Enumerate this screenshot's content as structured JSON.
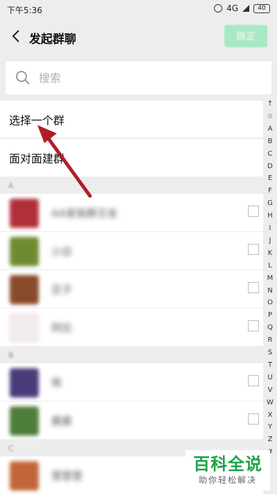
{
  "status_bar": {
    "time": "下午5:36",
    "network": "4G",
    "battery": "40"
  },
  "navbar": {
    "title": "发起群聊",
    "confirm_label": "确定"
  },
  "search": {
    "placeholder": "搜索"
  },
  "options": [
    {
      "label": "选择一个群"
    },
    {
      "label": "面对面建群"
    }
  ],
  "sections": [
    {
      "header": "A"
    },
    {
      "header": "B"
    },
    {
      "header": "C"
    }
  ],
  "contacts": [
    {
      "name": "AA家族群交友",
      "avatar_color": "#b0303a"
    },
    {
      "name": "小白",
      "avatar_color": "#6f8b2f"
    },
    {
      "name": "豆子",
      "avatar_color": "#8a4a2a"
    },
    {
      "name": "阿拉",
      "avatar_color": "#f2eded"
    },
    {
      "name": "雨",
      "avatar_color": "#4b3a7a"
    },
    {
      "name": "晨晨",
      "avatar_color": "#4f7d3a"
    },
    {
      "name": "慧慧慧",
      "avatar_color": "#c2663a"
    }
  ],
  "index_letters": [
    "↑",
    "☆",
    "A",
    "B",
    "C",
    "D",
    "E",
    "F",
    "G",
    "H",
    "I",
    "J",
    "K",
    "L",
    "M",
    "N",
    "O",
    "P",
    "Q",
    "R",
    "S",
    "T",
    "U",
    "V",
    "W",
    "X",
    "Y",
    "Z",
    "#"
  ],
  "watermark": {
    "title": "百科全说",
    "subtitle": "助你轻松解决"
  },
  "colors": {
    "accent": "#07c160",
    "arrow": "#b01e25",
    "watermark_green": "#1aa34a"
  }
}
